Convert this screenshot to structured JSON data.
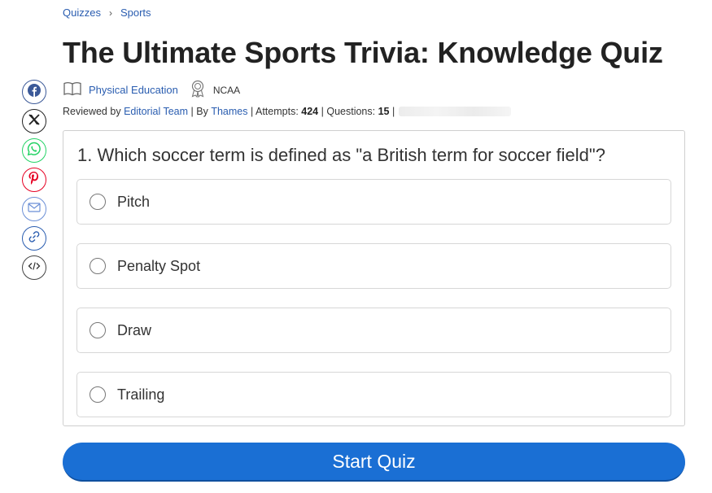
{
  "breadcrumb": {
    "items": [
      "Quizzes",
      "Sports"
    ],
    "separator": "›"
  },
  "title": "The Ultimate Sports Trivia: Knowledge Quiz",
  "meta": {
    "category": "Physical Education",
    "category_icon": "book-icon",
    "tag": "NCAA",
    "tag_icon": "award-icon"
  },
  "credits": {
    "reviewed_by_prefix": "Reviewed by",
    "reviewer": "Editorial Team",
    "by_prefix": "| By",
    "author": "Thames",
    "attempts_prefix": "| Attempts:",
    "attempts": "424",
    "questions_prefix": "| Questions:",
    "questions": "15",
    "trailing_sep": "|"
  },
  "share": {
    "items": [
      "facebook-icon",
      "x-icon",
      "whatsapp-icon",
      "pinterest-icon",
      "email-icon",
      "link-icon",
      "embed-icon"
    ]
  },
  "quiz": {
    "question": "1. Which soccer term is defined as \"a British term for soccer field\"?",
    "options": [
      "Pitch",
      "Penalty Spot",
      "Draw",
      "Trailing"
    ]
  },
  "start_button": "Start Quiz",
  "colors": {
    "accent": "#1a6fd4",
    "link": "#2a5db0"
  }
}
